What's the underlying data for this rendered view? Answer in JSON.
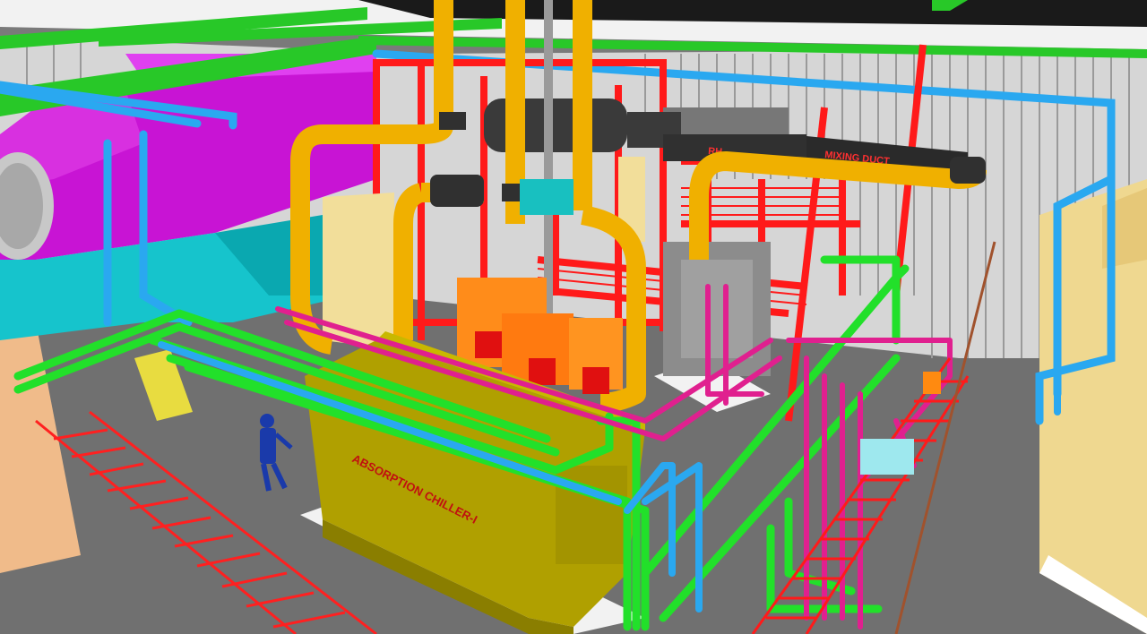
{
  "labels": {
    "chiller_label": "ABSORPTION CHILLER-I",
    "duct_label": "MIXING DUCT",
    "duct_label_prefix": "RH"
  },
  "colors": {
    "floor": "#6e6e6e",
    "floor_light": "#8a8a8a",
    "wall_panel": "#d8d8d8",
    "wall_line": "#8f8f8f",
    "steel_red": "#ff1a1a",
    "pipe_yellow": "#f5b800",
    "pipe_green": "#22e02a",
    "pipe_blue": "#2aa8f0",
    "pipe_magenta": "#e0208f",
    "duct_magenta": "#c010d0",
    "duct_cyan": "#18c8d0",
    "chiller_olive": "#b0a000",
    "panel_orange": "#ff8a10",
    "equipment_gray": "#8c8c8c",
    "cream_wall": "#f4dc94",
    "figure_blue": "#1a3aaa"
  },
  "icons": {
    "figure": "person-icon"
  }
}
